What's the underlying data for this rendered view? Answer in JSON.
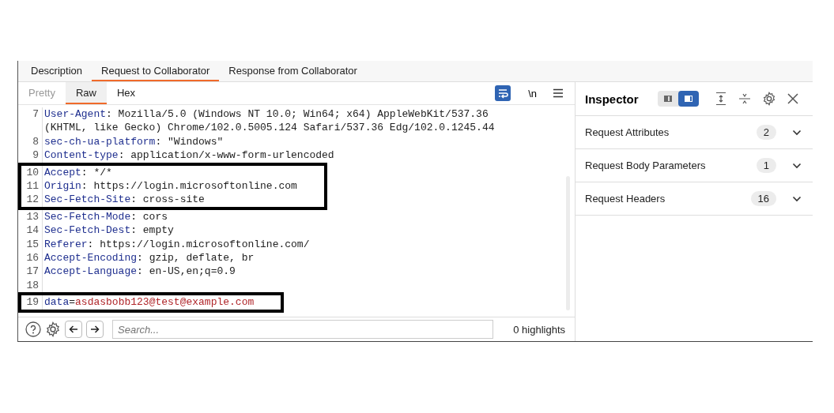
{
  "tabs": [
    {
      "label": "Description",
      "selected": false
    },
    {
      "label": "Request to Collaborator",
      "selected": true
    },
    {
      "label": "Response from Collaborator",
      "selected": false
    }
  ],
  "view_tabs": [
    {
      "label": "Pretty",
      "selected": false,
      "disabled": true
    },
    {
      "label": "Raw",
      "selected": true,
      "disabled": false
    },
    {
      "label": "Hex",
      "selected": false,
      "disabled": false
    }
  ],
  "toolbar": {
    "wrap_on": true,
    "newline_label": "\\n"
  },
  "groups": [
    {
      "boxed": false,
      "lines": [
        {
          "kind": "header",
          "number": "7",
          "key": "User-Agent",
          "sep": ": ",
          "value": "Mozilla/5.0 (Windows NT 10.0; Win64; x64) AppleWebKit/537.36 (KHTML, like Gecko) Chrome/102.0.5005.124 Safari/537.36 Edg/102.0.1245.44"
        },
        {
          "kind": "header",
          "number": "8",
          "key": "sec-ch-ua-platform",
          "sep": ": ",
          "value": "\"Windows\""
        },
        {
          "kind": "header",
          "number": "9",
          "key": "Content-type",
          "sep": ": ",
          "value": "application/x-www-form-urlencoded"
        }
      ]
    },
    {
      "boxed": true,
      "lines": [
        {
          "kind": "header",
          "number": "10",
          "key": "Accept",
          "sep": ": ",
          "value": "*/*"
        },
        {
          "kind": "header",
          "number": "11",
          "key": "Origin",
          "sep": ": ",
          "value": "https://login.microsoftonline.com"
        },
        {
          "kind": "header",
          "number": "12",
          "key": "Sec-Fetch-Site",
          "sep": ": ",
          "value": "cross-site"
        }
      ]
    },
    {
      "boxed": false,
      "lines": [
        {
          "kind": "header",
          "number": "13",
          "key": "Sec-Fetch-Mode",
          "sep": ": ",
          "value": "cors"
        },
        {
          "kind": "header",
          "number": "14",
          "key": "Sec-Fetch-Dest",
          "sep": ": ",
          "value": "empty"
        },
        {
          "kind": "header",
          "number": "15",
          "key": "Referer",
          "sep": ": ",
          "value": "https://login.microsoftonline.com/"
        },
        {
          "kind": "header",
          "number": "16",
          "key": "Accept-Encoding",
          "sep": ": ",
          "value": "gzip, deflate, br"
        },
        {
          "kind": "header",
          "number": "17",
          "key": "Accept-Language",
          "sep": ": ",
          "value": "en-US,en;q=0.9"
        },
        {
          "kind": "blank",
          "number": "18"
        }
      ]
    },
    {
      "boxed": true,
      "lines": [
        {
          "kind": "body",
          "number": "19",
          "key": "data",
          "sep": "=",
          "value": "asdasbobb123@test@example.com"
        }
      ]
    }
  ],
  "search": {
    "placeholder": "Search...",
    "highlights": "0 highlights"
  },
  "inspector": {
    "title": "Inspector",
    "layouts": [
      {
        "selected": false
      },
      {
        "selected": true
      }
    ],
    "sections": [
      {
        "label": "Request Attributes",
        "count": "2",
        "expanded": false
      },
      {
        "label": "Request Body Parameters",
        "count": "1",
        "expanded": false
      },
      {
        "label": "Request Headers",
        "count": "16",
        "expanded": false
      }
    ]
  }
}
